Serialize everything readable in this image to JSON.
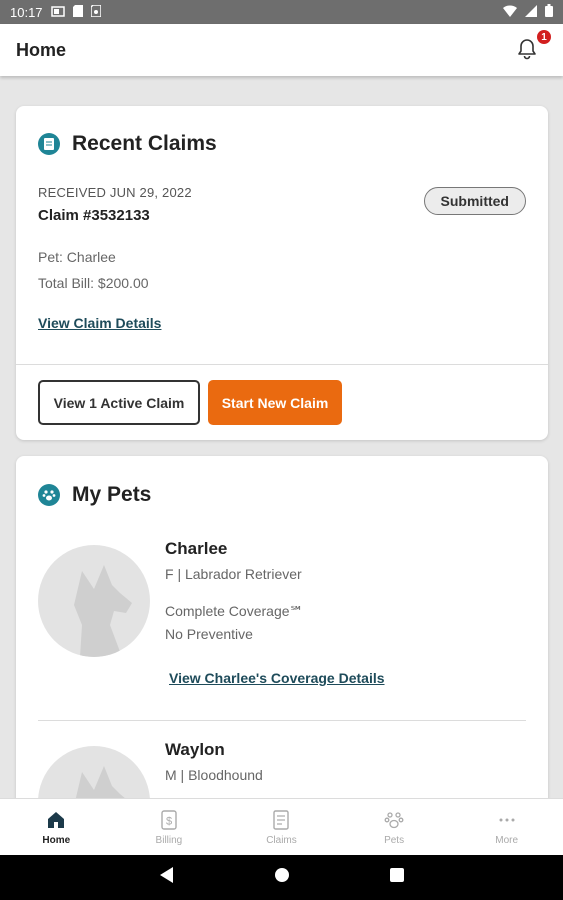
{
  "status_bar": {
    "time": "10:17"
  },
  "app_bar": {
    "title": "Home",
    "notification_count": "1"
  },
  "recent_claims": {
    "title": "Recent Claims",
    "received": "RECEIVED JUN 29, 2022",
    "claim_number": "Claim #3532133",
    "status": "Submitted",
    "pet": "Pet: Charlee",
    "total_bill": "Total Bill: $200.00",
    "details_link": "View Claim Details",
    "active_claim_button": "View 1 Active Claim",
    "new_claim_button": "Start New Claim"
  },
  "my_pets": {
    "title": "My Pets",
    "pets": [
      {
        "name": "Charlee",
        "info": "F | Labrador Retriever",
        "coverage": "Complete Coverage℠",
        "preventive": "No Preventive",
        "link": "View Charlee's Coverage Details"
      },
      {
        "name": "Waylon",
        "info": "M | Bloodhound"
      }
    ]
  },
  "bottom_nav": {
    "items": [
      {
        "label": "Home",
        "icon": "home-icon",
        "active": true
      },
      {
        "label": "Billing",
        "icon": "dollar-icon",
        "active": false
      },
      {
        "label": "Claims",
        "icon": "document-icon",
        "active": false
      },
      {
        "label": "Pets",
        "icon": "paw-icon",
        "active": false
      },
      {
        "label": "More",
        "icon": "more-icon",
        "active": false
      }
    ]
  },
  "colors": {
    "accent": "#ea6a10",
    "teal": "#1f8596",
    "link": "#1e4b5a",
    "badge": "#d21f1f"
  }
}
